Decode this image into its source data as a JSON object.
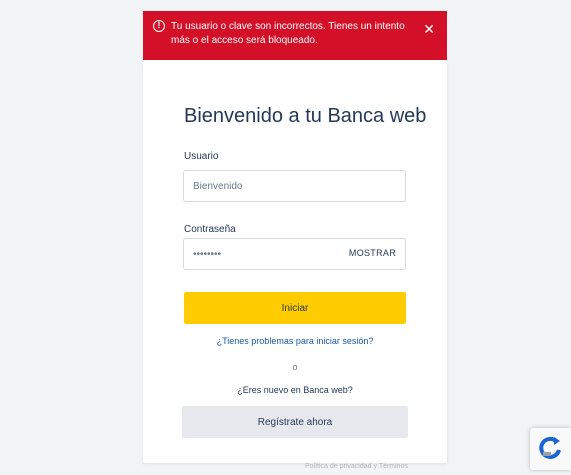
{
  "alert": {
    "message": "Tu usuario o clave son incorrectos. Tienes un intento más o el acceso será bloqueado.",
    "icon": "error-circle-icon",
    "close": "✕",
    "background": "#d31027"
  },
  "login": {
    "title": "Bienvenido a tu Banca web",
    "username_label": "Usuario",
    "username_value": "Bienvenido",
    "password_label": "Contraseña",
    "password_value": "••••••••",
    "show_password": "MOSTRAR",
    "submit": "Iniciar",
    "forgot_link": "¿Tienes problemas para iniciar sesión?",
    "separator": "o",
    "register_question": "¿Eres nuevo en Banca web?",
    "register_button": "Regístrate ahora"
  },
  "footer": {
    "text": "Política de privacidad y Términos"
  },
  "colors": {
    "primary_button": "#ffcc00",
    "secondary_button": "#e6e8ee",
    "text": "#253858",
    "link": "#1a5aa8"
  }
}
